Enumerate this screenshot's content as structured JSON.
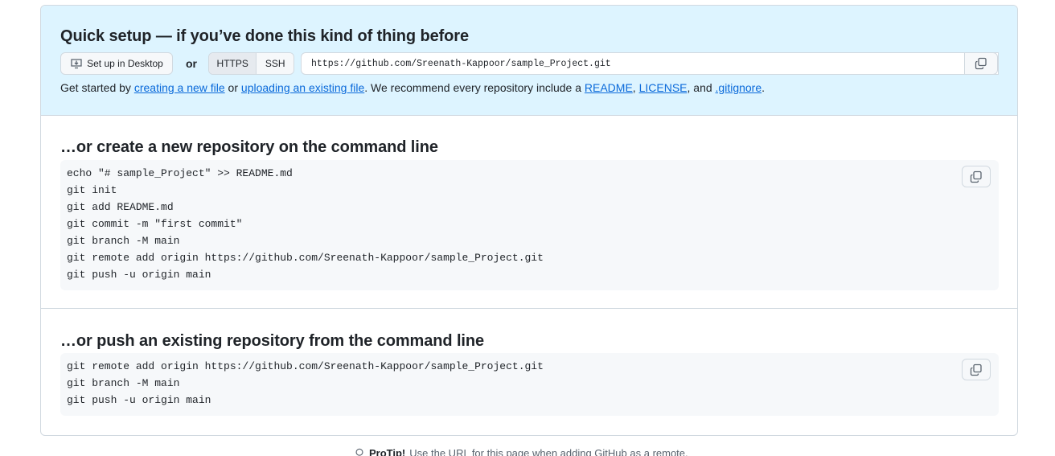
{
  "quick_setup": {
    "title": "Quick setup — if you’ve done this kind of thing before",
    "desktop_button": "Set up in Desktop",
    "or": "or",
    "protocols": [
      "HTTPS",
      "SSH"
    ],
    "selected_protocol": "HTTPS",
    "clone_url": "https://github.com/Sreenath-Kappoor/sample_Project.git",
    "get_started": {
      "prefix": "Get started by ",
      "link_new_file": "creating a new file",
      "or": " or ",
      "link_upload": "uploading an existing file",
      "recommend": ". We recommend every repository include a ",
      "link_readme": "README",
      "comma1": ", ",
      "link_license": "LICENSE",
      "and": ", and ",
      "link_gitignore": ".gitignore",
      "suffix": "."
    }
  },
  "new_repo": {
    "title": "…or create a new repository on the command line",
    "lines": [
      "echo \"# sample_Project\" >> README.md",
      "git init",
      "git add README.md",
      "git commit -m \"first commit\"",
      "git branch -M main",
      "git remote add origin https://github.com/Sreenath-Kappoor/sample_Project.git",
      "git push -u origin main"
    ]
  },
  "push_existing": {
    "title": "…or push an existing repository from the command line",
    "lines": [
      "git remote add origin https://github.com/Sreenath-Kappoor/sample_Project.git",
      "git branch -M main",
      "git push -u origin main"
    ]
  },
  "protip": {
    "label": "ProTip!",
    "text": "Use the URL for this page when adding GitHub as a remote."
  },
  "icons": {
    "desktop": "desktop-download-icon",
    "copy": "copy-icon",
    "protip": "light-bulb-icon"
  }
}
